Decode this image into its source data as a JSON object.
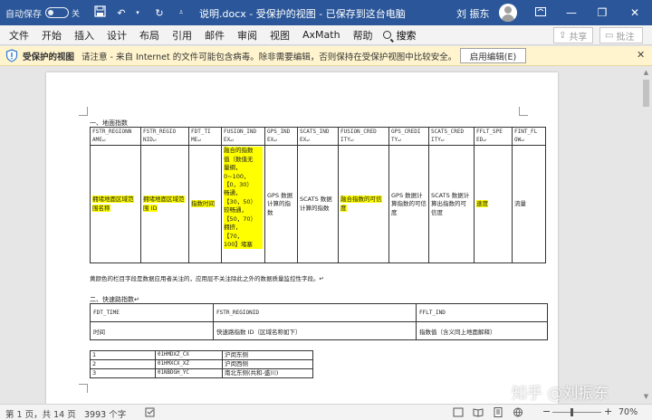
{
  "titlebar": {
    "autosave_label": "自动保存",
    "autosave_state": "关",
    "doc_title": "说明.docx  -  受保护的视图  -  已保存到这台电脑",
    "user_name": "刘 振东",
    "minimize": "—",
    "restore": "❐",
    "close": "✕"
  },
  "ribbon": {
    "tabs": [
      "文件",
      "开始",
      "插入",
      "设计",
      "布局",
      "引用",
      "邮件",
      "审阅",
      "视图",
      "AxMath",
      "帮助"
    ],
    "search_label": "搜索",
    "share_label": "共享",
    "comment_label": "批注"
  },
  "protected_view": {
    "title": "受保护的视图",
    "message": "请注意 - 来自 Internet 的文件可能包含病毒。除非需要编辑，否则保持在受保护视图中比较安全。",
    "enable_button": "启用编辑(E)",
    "close_icon": "✕"
  },
  "document": {
    "section1_title": "一、地面指数",
    "table1": {
      "headers": [
        "FSTR_REGIONNAME",
        "FSTR_REGIONID",
        "FDT_TIME",
        "FUSION_INDEX",
        "GPS_INDEX",
        "SCATS_INDEX",
        "FUSION_CREDITY",
        "GPS_CREDITY",
        "SCATS_CREDITY",
        "FFLT_SPEED",
        "FINT_FLOW"
      ],
      "header_display": [
        "FSTR_REGIONN AME↵",
        "FSTR_REGIO NID↵",
        "FDT_TI ME↵",
        "FUSION_IND EX↵",
        "GPS_IND EX↵",
        "SCATS_IND EX↵",
        "FUSION_CRED ITY↵",
        "GPS_CREDI TY↵",
        "SCATS_CRED ITY↵",
        "FFLT_SPE ED↵",
        "FINT_FL OW↵"
      ],
      "row": [
        "拥堵地面区域范围名称",
        "拥堵地面区域范围 ID",
        "指数时间",
        "融合的指数值（数值无量纲，0~100，【0，30）畅通，【30，50）较畅通，【50，70）拥挤，【70，100】堵塞",
        "GPS 数据计算的指数",
        "SCATS 数据计算的指数",
        "融合指数的可信度",
        "GPS 数据计算指数的可信度",
        "SCATS 数据计算出指数的可信度",
        "速度",
        "流量"
      ],
      "fusion_lines": [
        "融合的指数",
        "值（数值无",
        "量纲，",
        "0~100，",
        "【0，30）",
        "畅通，",
        "【30，50）",
        "较畅通，",
        "【50，70）",
        "拥挤，",
        "【70，",
        "100】堵塞"
      ]
    },
    "note": "黄颜色的栏目字段是数据应用者关注的，应用层不关注除此之外的数据质量监控性字段。↵",
    "section2_title": "二、快速路指数↵",
    "table2": {
      "headers": [
        "FDT_TIME",
        "FSTR_REGIONID",
        "FFLT_IND"
      ],
      "row": [
        "时间",
        "快速路指数 ID（区域名称如下）",
        "指数值（含义同上地面解释）"
      ]
    },
    "table3": {
      "rows": [
        [
          "1",
          "01HMDXZ_CX",
          "沪闵东侧"
        ],
        [
          "2",
          "01HMXCX_XZ",
          "沪闵西侧"
        ],
        [
          "3",
          "01NBDGH_YC",
          "南北东侧(共和-盛川)"
        ]
      ]
    }
  },
  "statusbar": {
    "pages": "第 1 页，共 14 页",
    "words": "3993 个字",
    "zoom_minus": "−",
    "zoom_plus": "+",
    "zoom_level": "70%",
    "zoom_fraction": 0.4
  },
  "watermark": "知乎 @刘振东"
}
